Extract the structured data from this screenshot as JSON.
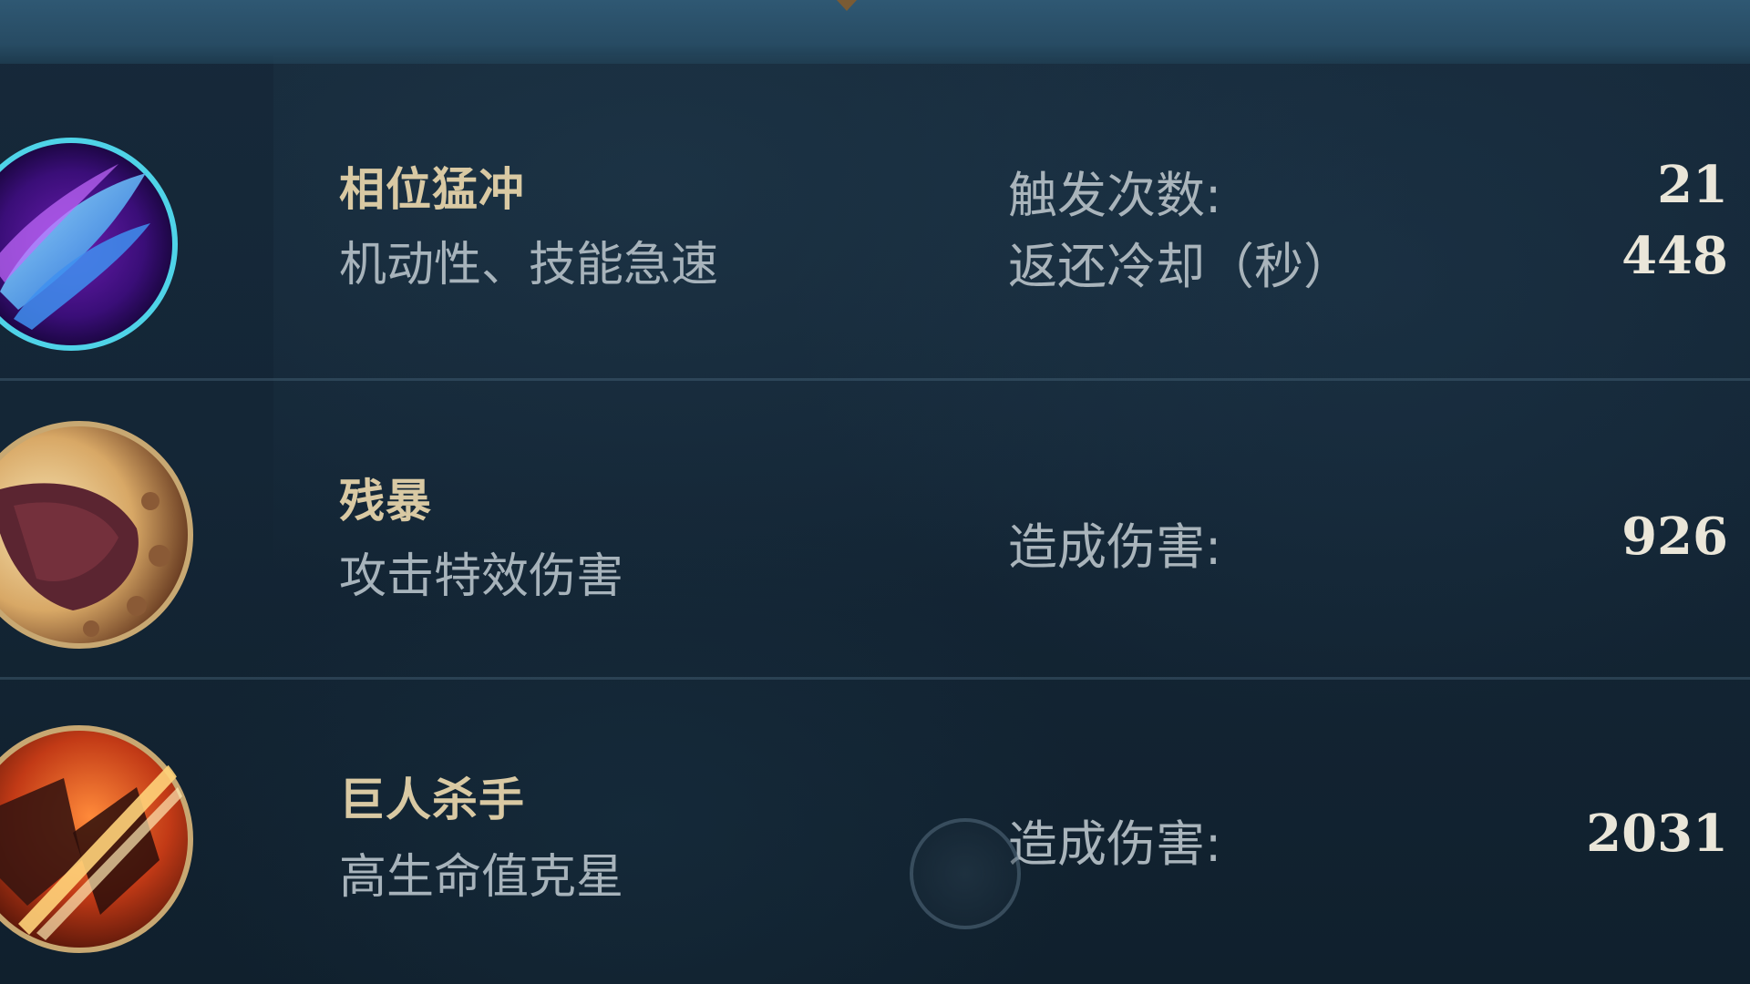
{
  "runes": [
    {
      "icon": "phase-rush-icon",
      "title": "相位猛冲",
      "subtitle": "机动性、技能急速",
      "stats": [
        {
          "label": "触发次数:",
          "value": "21"
        },
        {
          "label": "返还冷却（秒）",
          "value": "448"
        }
      ]
    },
    {
      "icon": "cut-down-icon",
      "title": "残暴",
      "subtitle": "攻击特效伤害",
      "stats": [
        {
          "label": "造成伤害:",
          "value": "926"
        }
      ]
    },
    {
      "icon": "giant-slayer-icon",
      "title": "巨人杀手",
      "subtitle": "高生命值克星",
      "stats": [
        {
          "label": "造成伤害:",
          "value": "2031"
        }
      ]
    }
  ],
  "colors": {
    "title": "#d9c9a3",
    "label": "#a9b4bb",
    "value": "#eae6d9",
    "background": "#142636"
  }
}
